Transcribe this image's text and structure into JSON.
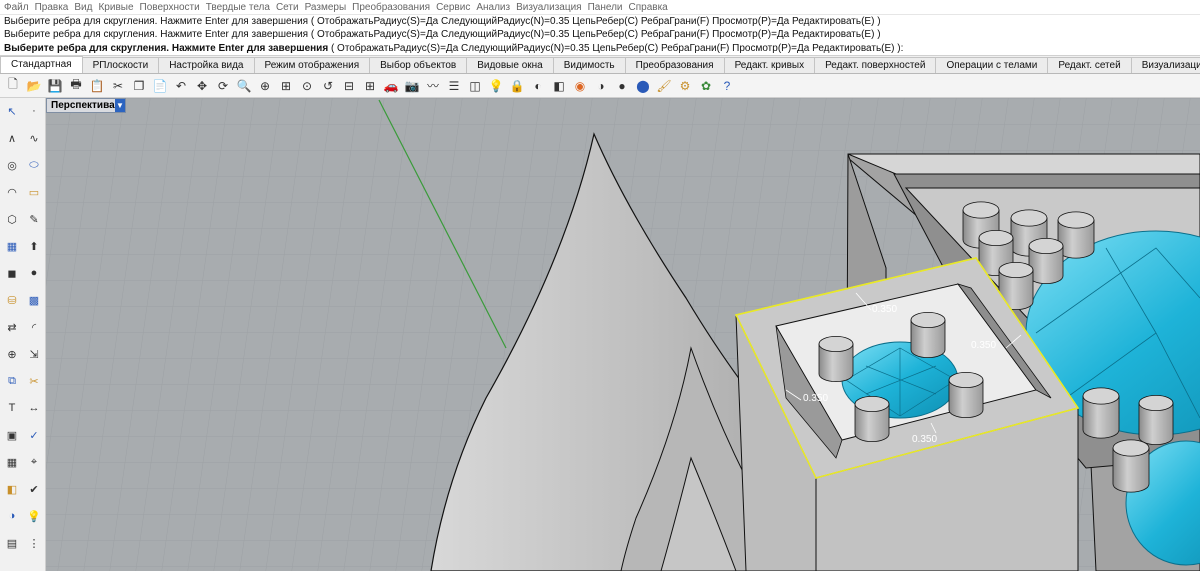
{
  "menubar": {
    "items": [
      "Файл",
      "Правка",
      "Вид",
      "Кривые",
      "Поверхности",
      "Твердые тела",
      "Сети",
      "Размеры",
      "Преобразования",
      "Сервис",
      "Анализ",
      "Визуализация",
      "Панели",
      "Справка"
    ]
  },
  "history": {
    "line1": "Выберите ребра для скругления. Нажмите Enter для завершения ( ОтображатьРадиус(S)=Да  СледующийРадиус(N)=0.35  ЦепьРебер(C)  РебраГрани(F)  Просмотр(P)=Да  Редактировать(E) )",
    "line2": "Выберите ребра для скругления. Нажмите Enter для завершения ( ОтображатьРадиус(S)=Да  СледующийРадиус(N)=0.35  ЦепьРебер(C)  РебраГрани(F)  Просмотр(P)=Да  Редактировать(E) )"
  },
  "command": {
    "prompt": "Выберите ребра для скругления. Нажмите Enter для завершения",
    "options": " ( ОтображатьРадиус(S)=Да  СледующийРадиус(N)=0.35  ЦепьРебер(C)  РебраГрани(F)  Просмотр(P)=Да  Редактировать(E) ):"
  },
  "tabs": [
    {
      "label": "Стандартная",
      "active": true
    },
    {
      "label": "РПлоскости"
    },
    {
      "label": "Настройка вида"
    },
    {
      "label": "Режим отображения"
    },
    {
      "label": "Выбор объектов"
    },
    {
      "label": "Видовые окна"
    },
    {
      "label": "Видимость"
    },
    {
      "label": "Преобразования"
    },
    {
      "label": "Редакт. кривых"
    },
    {
      "label": "Редакт. поверхностей"
    },
    {
      "label": "Операции с телами"
    },
    {
      "label": "Редакт. сетей"
    },
    {
      "label": "Визуализация"
    },
    {
      "label": "Черчение"
    }
  ],
  "toolbar_icons": [
    "new-file-icon",
    "open-folder-icon",
    "save-icon",
    "print-icon",
    "import-icon",
    "cut-icon",
    "copy-icon",
    "paste-icon",
    "undo-icon",
    "pan-icon",
    "rotate-view-icon",
    "zoom-icon",
    "zoom-window-icon",
    "zoom-extents-icon",
    "zoom-selected-icon",
    "undo-view-icon",
    "cplane-icon",
    "four-viewports-icon",
    "car-icon",
    "camera-icon",
    "wire-icon",
    "object-properties-icon",
    "select-all-icon",
    "light-icon",
    "lock-icon",
    "hide-icon",
    "layer-icon",
    "color-wheel-icon",
    "shade-icon",
    "render-icon",
    "rendered-sphere-icon",
    "paint-icon",
    "options-gear-icon",
    "grasshopper-icon",
    "help-icon"
  ],
  "left_tools": [
    "select-arrow-icon",
    "point-icon",
    "polyline-icon",
    "curve-icon",
    "circle-icon",
    "ellipse-icon",
    "arc-icon",
    "rectangle-icon",
    "polygon-icon",
    "freeform-icon",
    "surface-icon",
    "extrude-icon",
    "box-icon",
    "sphere-icon",
    "cylinder-icon",
    "mesh-icon",
    "transform-icon",
    "fillet-icon",
    "boolean-icon",
    "offset-icon",
    "join-icon",
    "trim-icon",
    "text-icon",
    "dimension-icon",
    "block-icon",
    "analyze-icon",
    "grid-icon",
    "snap-icon",
    "layer-panel-icon",
    "check-icon",
    "render-tool-icon",
    "light-tool-icon",
    "group-icon",
    "array-icon"
  ],
  "viewport": {
    "label": "Перспектива",
    "labels": {
      "r1": "0.350",
      "r2": "0.350",
      "r3": "0.350",
      "r4": "0.350"
    }
  },
  "colors": {
    "viewport_bg": "#a8acaf",
    "grid_line": "#9da1a4",
    "gem": "#1eb3d8",
    "selection": "#e8e829",
    "axis_green": "#3a9b3a"
  }
}
